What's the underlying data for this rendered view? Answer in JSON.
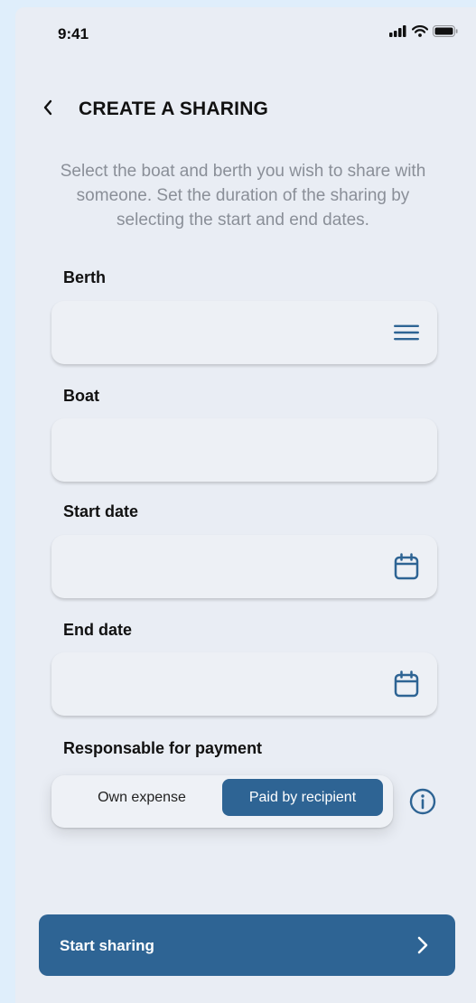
{
  "status_bar": {
    "time": "9:41"
  },
  "header": {
    "title": "CREATE A SHARING"
  },
  "intro": "Select the boat and berth you wish to share with someone. Set the duration of the sharing by selecting the start and end dates.",
  "fields": {
    "berth": {
      "label": "Berth",
      "value": "",
      "icon": "menu-icon"
    },
    "boat": {
      "label": "Boat",
      "value": ""
    },
    "start_date": {
      "label": "Start date",
      "value": "",
      "icon": "calendar-icon"
    },
    "end_date": {
      "label": "End date",
      "value": "",
      "icon": "calendar-icon"
    }
  },
  "payment": {
    "label": "Responsable for payment",
    "options": [
      "Own expense",
      "Paid by recipient"
    ],
    "selected": "Paid by recipient",
    "info_icon": "info-icon"
  },
  "primary_action": {
    "label": "Start sharing",
    "icon": "chevron-right-icon"
  },
  "colors": {
    "accent": "#2e6494",
    "background": "#e9edf4",
    "muted_text": "#8a8f98"
  }
}
